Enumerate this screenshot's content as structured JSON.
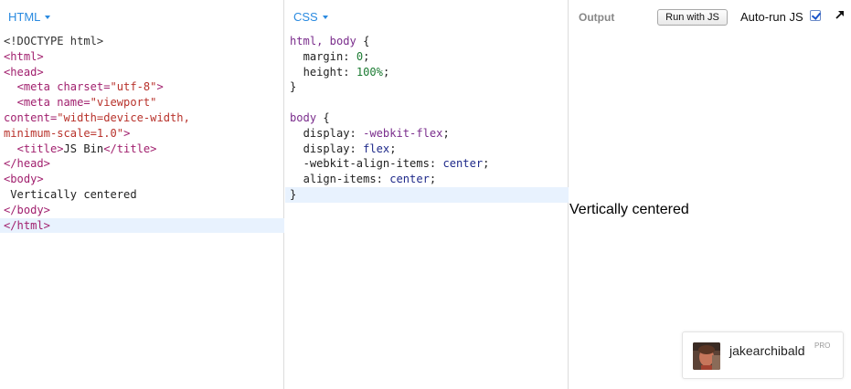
{
  "panels": {
    "html_label": "HTML",
    "css_label": "CSS",
    "output_label": "Output"
  },
  "toolbar": {
    "run_button": "Run with JS",
    "autorun_label": "Auto-run JS",
    "autorun_checked": true
  },
  "html_code": [
    [
      {
        "t": "<!DOCTYPE html>",
        "c": "t-doc"
      }
    ],
    [
      {
        "t": "<html>",
        "c": "t-tag"
      }
    ],
    [
      {
        "t": "<head>",
        "c": "t-tag"
      }
    ],
    [
      {
        "t": "  "
      },
      {
        "t": "<meta",
        "c": "t-tag"
      },
      {
        "t": " charset=",
        "c": "t-attr"
      },
      {
        "t": "\"utf-8\"",
        "c": "t-str"
      },
      {
        "t": ">",
        "c": "t-tag"
      }
    ],
    [
      {
        "t": "  "
      },
      {
        "t": "<meta",
        "c": "t-tag"
      },
      {
        "t": " name=",
        "c": "t-attr"
      },
      {
        "t": "\"viewport\"",
        "c": "t-str"
      }
    ],
    [
      {
        "t": "content=",
        "c": "t-attr"
      },
      {
        "t": "\"width=device-width,",
        "c": "t-str"
      }
    ],
    [
      {
        "t": "minimum-scale=1.0\"",
        "c": "t-str"
      },
      {
        "t": ">",
        "c": "t-tag"
      }
    ],
    [
      {
        "t": "  "
      },
      {
        "t": "<title>",
        "c": "t-tag"
      },
      {
        "t": "JS Bin"
      },
      {
        "t": "</title>",
        "c": "t-tag"
      }
    ],
    [
      {
        "t": "</head>",
        "c": "t-tag"
      }
    ],
    [
      {
        "t": "<body>",
        "c": "t-tag"
      }
    ],
    [
      {
        "t": " Vertically centered"
      }
    ],
    [
      {
        "t": "</body>",
        "c": "t-tag"
      }
    ],
    [
      {
        "t": "</html>",
        "c": "t-tag"
      }
    ]
  ],
  "html_active_line": 12,
  "css_code": [
    [
      {
        "t": "html, body",
        "c": "t-sel"
      },
      {
        "t": " {"
      }
    ],
    [
      {
        "t": "  "
      },
      {
        "t": "margin",
        "c": "t-prop"
      },
      {
        "t": ": "
      },
      {
        "t": "0",
        "c": "t-num"
      },
      {
        "t": ";"
      }
    ],
    [
      {
        "t": "  "
      },
      {
        "t": "height",
        "c": "t-prop"
      },
      {
        "t": ": "
      },
      {
        "t": "100%",
        "c": "t-num"
      },
      {
        "t": ";"
      }
    ],
    [
      {
        "t": "}"
      }
    ],
    [
      {
        "t": ""
      }
    ],
    [
      {
        "t": "body",
        "c": "t-sel"
      },
      {
        "t": " {"
      }
    ],
    [
      {
        "t": "  "
      },
      {
        "t": "display",
        "c": "t-prop"
      },
      {
        "t": ": "
      },
      {
        "t": "-webkit-flex",
        "c": "t-vend"
      },
      {
        "t": ";"
      }
    ],
    [
      {
        "t": "  "
      },
      {
        "t": "display",
        "c": "t-prop"
      },
      {
        "t": ": "
      },
      {
        "t": "flex",
        "c": "t-kw"
      },
      {
        "t": ";"
      }
    ],
    [
      {
        "t": "  "
      },
      {
        "t": "-webkit-align-items",
        "c": "t-prop"
      },
      {
        "t": ": "
      },
      {
        "t": "center",
        "c": "t-kw"
      },
      {
        "t": ";"
      }
    ],
    [
      {
        "t": "  "
      },
      {
        "t": "align-items",
        "c": "t-prop"
      },
      {
        "t": ": "
      },
      {
        "t": "center",
        "c": "t-kw"
      },
      {
        "t": ";"
      }
    ],
    [
      {
        "t": "}"
      }
    ]
  ],
  "css_active_line": 10,
  "output": {
    "rendered_text": "Vertically centered"
  },
  "user": {
    "username": "jakearchibald",
    "badge": "PRO"
  },
  "colors": {
    "panel_label": "#2a8ae0",
    "active_line": "#e8f2fe"
  }
}
